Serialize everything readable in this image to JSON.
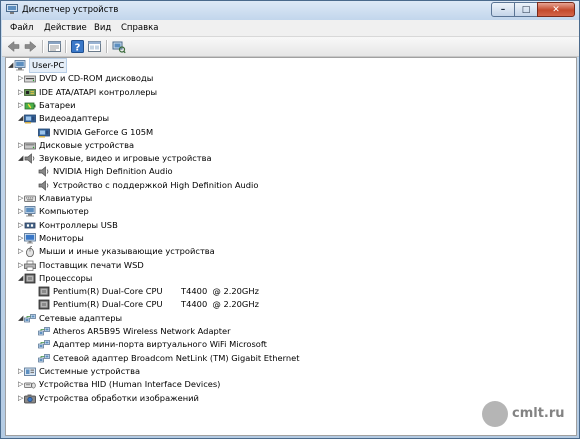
{
  "window": {
    "title": "Диспетчер устройств",
    "caption_buttons": [
      "minimize",
      "maximize",
      "close"
    ]
  },
  "menu": [
    "Файл",
    "Действие",
    "Вид",
    "Справка"
  ],
  "toolbar": [
    "back-arrow-icon",
    "forward-arrow-icon",
    "properties-icon",
    "help-icon",
    "details-view-icon",
    "scan-hardware-icon"
  ],
  "tree": [
    {
      "label": "User-PC",
      "level": 0,
      "expanded": true,
      "icon": "computer-icon",
      "selected": true
    },
    {
      "label": "DVD и CD-ROM дисководы",
      "level": 1,
      "expanded": false,
      "icon": "dvd-drive-icon"
    },
    {
      "label": "IDE ATA/ATAPI контроллеры",
      "level": 1,
      "expanded": false,
      "icon": "ide-controller-icon"
    },
    {
      "label": "Батареи",
      "level": 1,
      "expanded": false,
      "icon": "battery-icon"
    },
    {
      "label": "Видеоадаптеры",
      "level": 1,
      "expanded": true,
      "icon": "display-adapter-icon"
    },
    {
      "label": "NVIDIA GeForce G 105M",
      "level": 2,
      "icon": "display-adapter-icon"
    },
    {
      "label": "Дисковые устройства",
      "level": 1,
      "expanded": false,
      "icon": "disk-drive-icon"
    },
    {
      "label": "Звуковые, видео и игровые устройства",
      "level": 1,
      "expanded": true,
      "icon": "speaker-icon"
    },
    {
      "label": "NVIDIA High Definition Audio",
      "level": 2,
      "icon": "speaker-icon"
    },
    {
      "label": "Устройство с поддержкой High Definition Audio",
      "level": 2,
      "icon": "speaker-icon"
    },
    {
      "label": "Клавиатуры",
      "level": 1,
      "expanded": false,
      "icon": "keyboard-icon"
    },
    {
      "label": "Компьютер",
      "level": 1,
      "expanded": false,
      "icon": "computer-icon"
    },
    {
      "label": "Контроллеры USB",
      "level": 1,
      "expanded": false,
      "icon": "usb-icon"
    },
    {
      "label": "Мониторы",
      "level": 1,
      "expanded": false,
      "icon": "monitor-icon"
    },
    {
      "label": "Мыши и иные указывающие устройства",
      "level": 1,
      "expanded": false,
      "icon": "mouse-icon"
    },
    {
      "label": "Поставщик печати WSD",
      "level": 1,
      "expanded": false,
      "icon": "printer-icon"
    },
    {
      "label": "Процессоры",
      "level": 1,
      "expanded": true,
      "icon": "processor-icon"
    },
    {
      "label": "Pentium(R) Dual-Core CPU       T4400  @ 2.20GHz",
      "level": 2,
      "icon": "processor-icon"
    },
    {
      "label": "Pentium(R) Dual-Core CPU       T4400  @ 2.20GHz",
      "level": 2,
      "icon": "processor-icon"
    },
    {
      "label": "Сетевые адаптеры",
      "level": 1,
      "expanded": true,
      "icon": "network-adapter-icon"
    },
    {
      "label": "Atheros AR5B95 Wireless Network Adapter",
      "level": 2,
      "icon": "network-adapter-icon"
    },
    {
      "label": "Адаптер мини-порта виртуального WiFi Microsoft",
      "level": 2,
      "icon": "network-adapter-icon"
    },
    {
      "label": "Сетевой адаптер Broadcom NetLink (TM) Gigabit Ethernet",
      "level": 2,
      "icon": "network-adapter-icon"
    },
    {
      "label": "Системные устройства",
      "level": 1,
      "expanded": false,
      "icon": "system-device-icon"
    },
    {
      "label": "Устройства HID (Human Interface Devices)",
      "level": 1,
      "expanded": false,
      "icon": "hid-icon"
    },
    {
      "label": "Устройства обработки изображений",
      "level": 1,
      "expanded": false,
      "icon": "camera-icon"
    }
  ],
  "watermark": {
    "text": "cmlt.ru"
  },
  "colors": {
    "titlebar": "#c9dcef",
    "close_button": "#c44a2c",
    "selection": "#e5eef8"
  }
}
